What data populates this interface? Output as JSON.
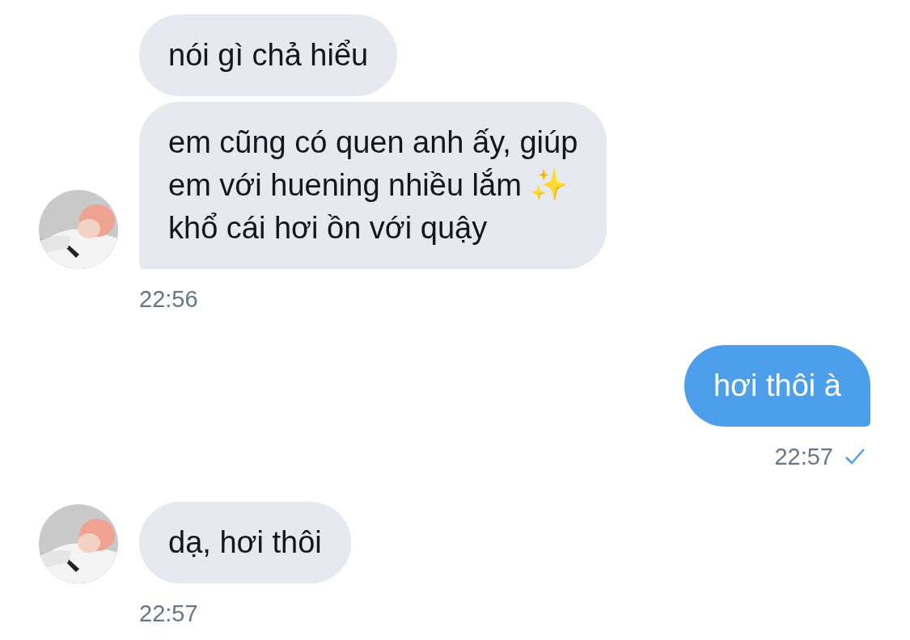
{
  "messages": [
    {
      "kind": "received",
      "bubbles": [
        "nói gì chả hiểu",
        "em cũng có quen anh ấy, giúp\nem với huening nhiều lắm ✨\nkhổ cái hơi ồn với quậy"
      ],
      "time": "22:56"
    },
    {
      "kind": "sent",
      "bubbles": [
        "hơi thôi à"
      ],
      "time": "22:57"
    },
    {
      "kind": "received",
      "bubbles": [
        "dạ, hơi thôi"
      ],
      "time": "22:57"
    }
  ]
}
